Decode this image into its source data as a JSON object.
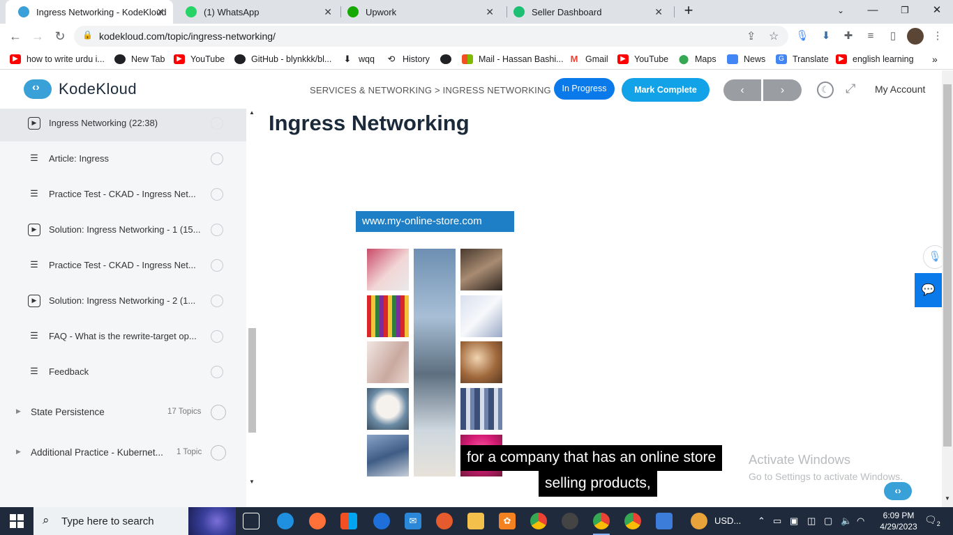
{
  "browser": {
    "tabs": [
      {
        "title": "Ingress Networking - KodeKloud",
        "active": true,
        "favicon_color": "#3aa0d8"
      },
      {
        "title": "(1) WhatsApp",
        "active": false,
        "favicon_color": "#25d366"
      },
      {
        "title": "Upwork",
        "active": false,
        "favicon_color": "#14a800"
      },
      {
        "title": "Seller Dashboard",
        "active": false,
        "favicon_color": "#1dbf73"
      }
    ],
    "url": "kodekloud.com/topic/ingress-networking/",
    "bookmarks": [
      {
        "label": "how to write urdu i...",
        "icon": "youtube-icon",
        "color": "#ff0000"
      },
      {
        "label": "New Tab",
        "icon": "globe-icon",
        "color": "#202124"
      },
      {
        "label": "YouTube",
        "icon": "youtube-icon",
        "color": "#ff0000"
      },
      {
        "label": "GitHub - blynkkk/bl...",
        "icon": "github-icon",
        "color": "#202124"
      },
      {
        "label": "wqq",
        "icon": "download-icon",
        "color": "#202124"
      },
      {
        "label": "History",
        "icon": "history-icon",
        "color": "#202124"
      },
      {
        "label": "",
        "icon": "globe-icon",
        "color": "#202124"
      },
      {
        "label": "Mail - Hassan Bashi...",
        "icon": "microsoft-icon",
        "color": "#f25022"
      },
      {
        "label": "Gmail",
        "icon": "gmail-icon",
        "color": "#ea4335"
      },
      {
        "label": "YouTube",
        "icon": "youtube-icon",
        "color": "#ff0000"
      },
      {
        "label": "Maps",
        "icon": "maps-icon",
        "color": "#34a853"
      },
      {
        "label": "News",
        "icon": "news-icon",
        "color": "#4285f4"
      },
      {
        "label": "Translate",
        "icon": "translate-icon",
        "color": "#4285f4"
      },
      {
        "label": "english learning",
        "icon": "youtube-icon",
        "color": "#ff0000"
      }
    ]
  },
  "header": {
    "brand": "KodeKloud",
    "breadcrumb": "SERVICES & NETWORKING > INGRESS NETWORKING",
    "status_button": "In Progress",
    "complete_button": "Mark Complete",
    "account_label": "My Account",
    "accent_color": "#0a7aea"
  },
  "sidebar": {
    "lessons": [
      {
        "label": "Ingress Networking (22:38)",
        "type": "video",
        "active": true
      },
      {
        "label": "Article: Ingress",
        "type": "article",
        "active": false
      },
      {
        "label": "Practice Test - CKAD - Ingress Net...",
        "type": "article",
        "active": false
      },
      {
        "label": "Solution: Ingress Networking - 1 (15...",
        "type": "video",
        "active": false
      },
      {
        "label": "Practice Test - CKAD - Ingress Net...",
        "type": "article",
        "active": false
      },
      {
        "label": "Solution: Ingress Networking - 2 (1...",
        "type": "video",
        "active": false
      },
      {
        "label": "FAQ - What is the rewrite-target op...",
        "type": "article",
        "active": false
      },
      {
        "label": "Feedback",
        "type": "article",
        "active": false
      }
    ],
    "sections": [
      {
        "title": "State Persistence",
        "count": "17 Topics"
      },
      {
        "title": "Additional Practice - Kubernet...",
        "count": "1 Topic"
      }
    ]
  },
  "main": {
    "title": "Ingress Networking",
    "video": {
      "store_url": "www.my-online-store.com",
      "caption_line1": "for a company that has an online store",
      "caption_line2": "selling products,"
    },
    "watermark_line1": "Activate Windows",
    "watermark_line2": "Go to Settings to activate Windows."
  },
  "taskbar": {
    "search_placeholder": "Type here to search",
    "tray_label": "USD...",
    "time": "6:09 PM",
    "date": "4/29/2023",
    "notifications": "2"
  }
}
